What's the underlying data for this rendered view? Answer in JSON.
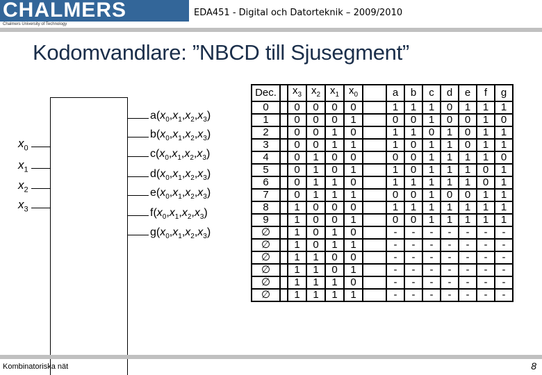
{
  "header": {
    "logo_text": "CHALMERS",
    "logo_subtitle": "Chalmers University of Technology",
    "course_title": "EDA451 - Digital och Datorteknik – 2009/2010"
  },
  "slide": {
    "title": "Kodomvandlare: ”NBCD till Sjusegment”"
  },
  "diagram": {
    "inputs": [
      {
        "var": "x",
        "sub": "0"
      },
      {
        "var": "x",
        "sub": "1"
      },
      {
        "var": "x",
        "sub": "2"
      },
      {
        "var": "x",
        "sub": "3"
      }
    ],
    "outputs": [
      {
        "name": "a"
      },
      {
        "name": "b"
      },
      {
        "name": "c"
      },
      {
        "name": "d"
      },
      {
        "name": "e"
      },
      {
        "name": "f"
      },
      {
        "name": "g"
      }
    ],
    "arg": {
      "var": "x",
      "subs": [
        "0",
        "1",
        "2",
        "3"
      ]
    }
  },
  "truth_table": {
    "headers": {
      "dec": "Dec.",
      "inputs": [
        {
          "var": "x",
          "sub": "3"
        },
        {
          "var": "x",
          "sub": "2"
        },
        {
          "var": "x",
          "sub": "1"
        },
        {
          "var": "x",
          "sub": "0"
        }
      ],
      "outputs": [
        "a",
        "b",
        "c",
        "d",
        "e",
        "f",
        "g"
      ]
    },
    "rows": [
      {
        "dec": "0",
        "x": [
          "0",
          "0",
          "0",
          "0"
        ],
        "out": [
          "1",
          "1",
          "1",
          "0",
          "1",
          "1",
          "1"
        ]
      },
      {
        "dec": "1",
        "x": [
          "0",
          "0",
          "0",
          "1"
        ],
        "out": [
          "0",
          "0",
          "1",
          "0",
          "0",
          "1",
          "0"
        ]
      },
      {
        "dec": "2",
        "x": [
          "0",
          "0",
          "1",
          "0"
        ],
        "out": [
          "1",
          "1",
          "0",
          "1",
          "0",
          "1",
          "1"
        ]
      },
      {
        "dec": "3",
        "x": [
          "0",
          "0",
          "1",
          "1"
        ],
        "out": [
          "1",
          "0",
          "1",
          "1",
          "0",
          "1",
          "1"
        ]
      },
      {
        "dec": "4",
        "x": [
          "0",
          "1",
          "0",
          "0"
        ],
        "out": [
          "0",
          "0",
          "1",
          "1",
          "1",
          "1",
          "0"
        ]
      },
      {
        "dec": "5",
        "x": [
          "0",
          "1",
          "0",
          "1"
        ],
        "out": [
          "1",
          "0",
          "1",
          "1",
          "1",
          "0",
          "1"
        ]
      },
      {
        "dec": "6",
        "x": [
          "0",
          "1",
          "1",
          "0"
        ],
        "out": [
          "1",
          "1",
          "1",
          "1",
          "1",
          "0",
          "1"
        ]
      },
      {
        "dec": "7",
        "x": [
          "0",
          "1",
          "1",
          "1"
        ],
        "out": [
          "0",
          "0",
          "1",
          "0",
          "0",
          "1",
          "1"
        ]
      },
      {
        "dec": "8",
        "x": [
          "1",
          "0",
          "0",
          "0"
        ],
        "out": [
          "1",
          "1",
          "1",
          "1",
          "1",
          "1",
          "1"
        ]
      },
      {
        "dec": "9",
        "x": [
          "1",
          "0",
          "0",
          "1"
        ],
        "out": [
          "0",
          "0",
          "1",
          "1",
          "1",
          "1",
          "1"
        ]
      },
      {
        "dec": "∅",
        "x": [
          "1",
          "0",
          "1",
          "0"
        ],
        "out": [
          "-",
          "-",
          "-",
          "-",
          "-",
          "-",
          "-"
        ]
      },
      {
        "dec": "∅",
        "x": [
          "1",
          "0",
          "1",
          "1"
        ],
        "out": [
          "-",
          "-",
          "-",
          "-",
          "-",
          "-",
          "-"
        ]
      },
      {
        "dec": "∅",
        "x": [
          "1",
          "1",
          "0",
          "0"
        ],
        "out": [
          "-",
          "-",
          "-",
          "-",
          "-",
          "-",
          "-"
        ]
      },
      {
        "dec": "∅",
        "x": [
          "1",
          "1",
          "0",
          "1"
        ],
        "out": [
          "-",
          "-",
          "-",
          "-",
          "-",
          "-",
          "-"
        ]
      },
      {
        "dec": "∅",
        "x": [
          "1",
          "1",
          "1",
          "0"
        ],
        "out": [
          "-",
          "-",
          "-",
          "-",
          "-",
          "-",
          "-"
        ]
      },
      {
        "dec": "∅",
        "x": [
          "1",
          "1",
          "1",
          "1"
        ],
        "out": [
          "-",
          "-",
          "-",
          "-",
          "-",
          "-",
          "-"
        ]
      }
    ]
  },
  "footer": {
    "left": "Kombinatoriska nät",
    "page_number": "8"
  },
  "colors": {
    "logo_bg": "#336699",
    "title": "#1a2e4a",
    "bar": "#c0c0c0"
  }
}
